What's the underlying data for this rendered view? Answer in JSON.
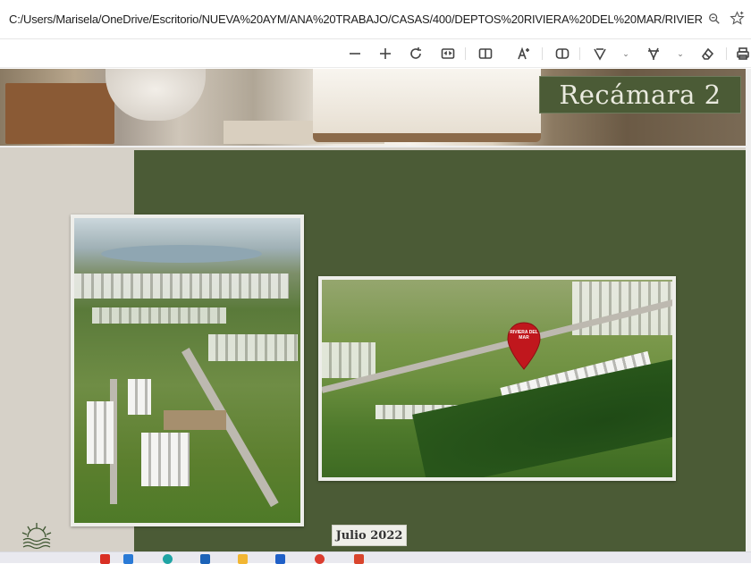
{
  "browser": {
    "url": "C:/Users/Marisela/OneDrive/Escritorio/NUEVA%20AYM/ANA%20TRABAJO/CASAS/400/DEPTOS%20RIVIERA%20DEL%20MAR/RIVIERA%20DE...",
    "zoom_icon": "zoom-icon",
    "favorite_icon": "favorite-star-icon"
  },
  "pdf_toolbar": {
    "tools": [
      {
        "name": "zoom-out-icon",
        "glyph": "—"
      },
      {
        "name": "zoom-in-icon",
        "glyph": "+"
      },
      {
        "name": "rotate-icon",
        "glyph": "⟳"
      },
      {
        "name": "fit-page-icon",
        "glyph": "⇔"
      },
      {
        "name": "page-view-icon",
        "glyph": "▯▯"
      },
      {
        "name": "read-aloud-icon",
        "glyph": "A"
      },
      {
        "name": "immersive-reader-icon",
        "glyph": "◫"
      },
      {
        "name": "draw-icon",
        "glyph": "▽"
      },
      {
        "name": "highlight-icon",
        "glyph": "▽"
      },
      {
        "name": "erase-icon",
        "glyph": "◇"
      },
      {
        "name": "print-icon",
        "glyph": "⎙"
      }
    ]
  },
  "slide": {
    "banner_title": "Recámara 2",
    "pin_label": "RIVIERA DEL MAR",
    "date_label": "Julio 2022",
    "colors": {
      "panel_green": "#4b5b36",
      "pin_red": "#c0171d",
      "background": "#d6d1c8"
    }
  }
}
